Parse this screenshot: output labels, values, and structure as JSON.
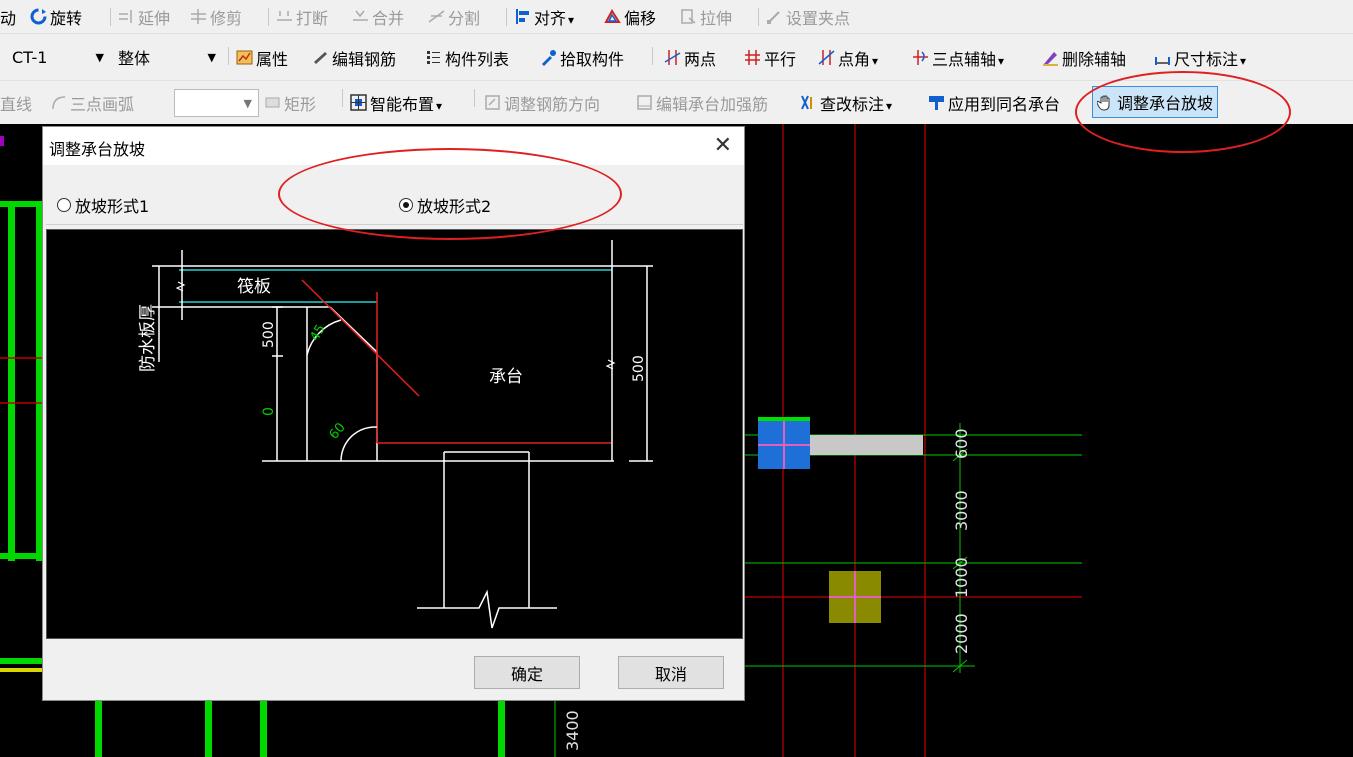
{
  "toolbar1": {
    "move": "动",
    "rotate": "旋转",
    "extend": "延伸",
    "trim": "修剪",
    "break": "打断",
    "merge": "合并",
    "split": "分割",
    "align": "对齐",
    "offset": "偏移",
    "stretch": "拉伸",
    "set_grip": "设置夹点"
  },
  "toolbar2": {
    "component_select": "CT-1",
    "scope_select": "整体",
    "properties": "属性",
    "edit_rebar": "编辑钢筋",
    "component_list": "构件列表",
    "pick_component": "拾取构件",
    "two_points": "两点",
    "parallel": "平行",
    "point_angle": "点角",
    "three_point_axis": "三点辅轴",
    "delete_axis": "删除辅轴",
    "dimension": "尺寸标注"
  },
  "toolbar3": {
    "line": "直线",
    "arc3": "三点画弧",
    "empty_select": "",
    "rectangle": "矩形",
    "smart_place": "智能布置",
    "adjust_rebar_dir": "调整钢筋方向",
    "edit_cap_rebar": "编辑承台加强筋",
    "modify_label": "查改标注",
    "apply_same_name": "应用到同名承台",
    "adjust_slope": "调整承台放坡"
  },
  "dialog": {
    "title": "调整承台放坡",
    "option1": "放坡形式1",
    "option2": "放坡形式2",
    "selected": "放坡形式2",
    "ok": "确定",
    "cancel": "取消",
    "diagram": {
      "raft": "筏板",
      "waterproof": "防水板厚",
      "cap": "承台",
      "dim_500_left": "500",
      "dim_0": "0",
      "dim_500_right": "500",
      "angle_45": "45",
      "angle_60": "60"
    }
  },
  "canvas": {
    "dim_600": "600",
    "dim_3000": "3000",
    "dim_1000": "1000",
    "dim_2000": "2000",
    "dim_3400": "3400"
  },
  "colors": {
    "annotation_red": "#e02020",
    "grid_green": "#00e000",
    "cap_blue": "#1e6fd8",
    "cap_olive": "#8a8a00"
  }
}
